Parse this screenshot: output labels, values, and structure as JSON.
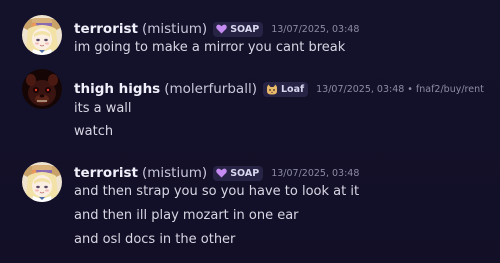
{
  "messages": [
    {
      "username": "terrorist",
      "handle": "(mistium)",
      "tag": {
        "icon": "heart-icon",
        "label": "SOAP",
        "color": "#c58bf2"
      },
      "timestamp": "13/07/2025, 03:48",
      "lines": [
        "im going to make a mirror you cant break"
      ]
    },
    {
      "username": "thigh highs",
      "handle": "(molerfurball)",
      "tag": {
        "icon": "cat-icon",
        "label": "Loaf",
        "color": "#e8b86b"
      },
      "timestamp": "13/07/2025, 03:48",
      "extra": "• fnaf2/buy/rent",
      "lines": [
        "its a wall",
        "watch"
      ]
    },
    {
      "username": "terrorist",
      "handle": "(mistium)",
      "tag": {
        "icon": "heart-icon",
        "label": "SOAP",
        "color": "#c58bf2"
      },
      "timestamp": "13/07/2025, 03:48",
      "lines": [
        "and then strap you so you have to look at it",
        "and then ill play mozart in one ear",
        "and osl docs in the other"
      ]
    }
  ]
}
